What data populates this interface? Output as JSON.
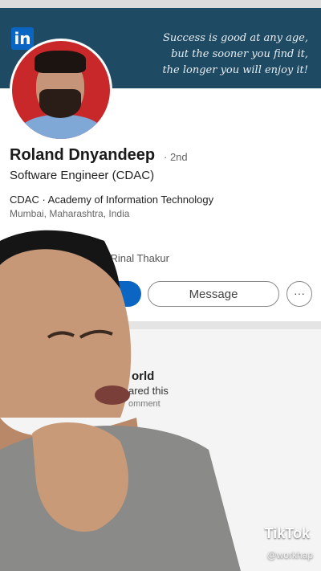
{
  "banner": {
    "logo": "in",
    "quote_lines": [
      "Success is good at any age,",
      "but the sooner you find it,",
      "the longer you will enjoy it!"
    ],
    "color": "#1f4a63"
  },
  "profile": {
    "name": "Roland Dnyandeep",
    "degree": "· 2nd",
    "headline": "Software Engineer (CDAC)",
    "company": "CDAC · Academy of Information Technology",
    "location": "Mumbai, Maharashtra, India",
    "mutual": "now Rinal Thakur"
  },
  "actions": {
    "message_label": "Message",
    "more_label": "···",
    "primary_color": "#0a66c2"
  },
  "feed": {
    "title": "orld",
    "shared": "ared this",
    "comment": "omment"
  },
  "watermark": {
    "brand": "TikTok",
    "handle": "@workhap"
  }
}
